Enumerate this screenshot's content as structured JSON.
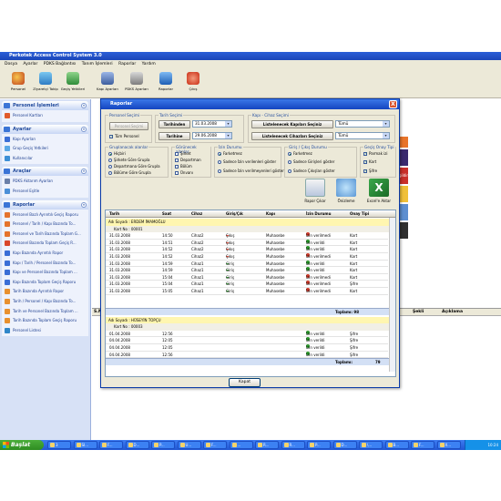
{
  "app": {
    "title": "Perkotek Access Control System 3.0",
    "menu": [
      "Dosya",
      "Ayarlar",
      "PDKS Bağlantısı",
      "Tanım İşlemleri",
      "Raporlar",
      "Yardım"
    ],
    "toolbar": [
      "Personel",
      "Ziyaretçi Takip",
      "Geçiş Yetkileri",
      "Kapı Ayarları",
      "PDKS Ayarları",
      "Raporlar",
      "Çıkış"
    ]
  },
  "sidebar": {
    "sections": [
      {
        "title": "Personel İşlemleri",
        "items": [
          "Personel Kartları"
        ]
      },
      {
        "title": "Ayarlar",
        "items": [
          "Kapı Ayarları",
          "Grup Geçiş Yetkileri",
          "Kullanıcılar"
        ]
      },
      {
        "title": "Araçlar",
        "items": [
          "PDKS Aktarım Ayarları",
          "Personel Eşitle"
        ]
      },
      {
        "title": "Raporlar",
        "items": [
          "Personel Bazlı Ayrıntılı Geçiş Raporu",
          "Personel / Tarih / Kapı Bazında To...",
          "Personel ve Tarih Bazında Toplam G...",
          "Personel Bazında Toplam Geçiş R...",
          "Kapı Bazında Ayrıntılı Rapor",
          "Kapı / Tarih / Personel Bazında To...",
          "Kapı ve Personel Bazında Toplam ...",
          "Kapı Bazında Toplam Geçiş Raporu",
          "Tarih Bazında Ayrıntılı Rapor",
          "Tarih / Personel / Kapı Bazında To...",
          "Tarih ve Personel Bazında Toplam ...",
          "Tarih Bazında Toplam Geçiş Raporu",
          "Personel Listesi"
        ]
      }
    ]
  },
  "background_table": {
    "headers": [
      "S.No",
      "Şekli",
      "Açıklama"
    ]
  },
  "ad_text": "gildir.",
  "dialog": {
    "title": "Raporlar",
    "close_label": "X",
    "personel_secimi": {
      "legend": "Personel Seçimi",
      "button": "Personel Seçimi",
      "all_label": "Tüm Personel"
    },
    "tarih_secimi": {
      "legend": "Tarih Seçimi",
      "from_label": "Tarihinden",
      "from_value": "31.03.2008",
      "to_label": "Tarihine",
      "to_value": "29.06.2008"
    },
    "kapi_cihaz_secimi": {
      "legend": "Kapı - Cihaz Seçimi",
      "kapi_label": "Listelenecek Kapıları Seçiniz",
      "kapi_value": "Tümü",
      "cihaz_label": "Listelenecek Cihazları Seçiniz",
      "cihaz_value": "Tümü"
    },
    "gruplama": {
      "legend": "Gruplanacak alanlar",
      "options": [
        "Hiçbiri",
        "Şirkete Göre Grupla",
        "Departmana Göre Grupla",
        "Bölüme Göre Grupla"
      ],
      "selected": 0
    },
    "gorunecek": {
      "legend": "Görünecek alanlar",
      "options": [
        "Şirket",
        "Departman",
        "Bölüm",
        "Ünvanı"
      ]
    },
    "izin_durumu": {
      "legend": "İzin Durumu",
      "options": [
        "Farketmez",
        "Sadece İzin verilenleri göster",
        "Sadece İzin verilmeyenleri göster"
      ],
      "selected": 0
    },
    "giris_cikis": {
      "legend": "Giriş / Çıkış Durumu",
      "options": [
        "Farketmez",
        "Sadece Girişleri göster",
        "Sadece Çıkışları göster"
      ],
      "selected": 0
    },
    "onay_tipi": {
      "legend": "Geçiş Onay Tipi",
      "options": [
        "Parmak izi",
        "Kart",
        "Şifre"
      ]
    },
    "actions": [
      "Rapor Çıkar",
      "Önizleme",
      "Excel'e Aktar"
    ],
    "grid": {
      "headers": [
        "Tarih",
        "Saat",
        "Cihaz",
        "Giriş/Çık",
        "Kapı",
        "İzin Durumu",
        "Onay Tipi"
      ],
      "groups": [
        {
          "name_label": "Adı Soyadı : ERDEM İMAMOĞLU",
          "card_label": "Kart No : 00001",
          "rows": [
            [
              "31.03.2008",
              "14:50",
              "Cihaz2",
              "Çıkış",
              "Muhasebe",
              "İzin verilmedi",
              "Kart"
            ],
            [
              "31.03.2008",
              "14:51",
              "Cihaz2",
              "Çıkış",
              "Muhasebe",
              "İzin verildi",
              "Kart"
            ],
            [
              "31.03.2008",
              "14:52",
              "Cihaz2",
              "Çıkış",
              "Muhasebe",
              "İzin verildi",
              "Kart"
            ],
            [
              "31.03.2008",
              "14:52",
              "Cihaz2",
              "Çıkış",
              "Muhasebe",
              "İzin verilmedi",
              "Kart"
            ],
            [
              "31.03.2008",
              "14:59",
              "Cihaz1",
              "Giriş",
              "Muhasebe",
              "İzin verildi",
              "Kart"
            ],
            [
              "31.03.2008",
              "14:59",
              "Cihaz1",
              "Giriş",
              "Muhasebe",
              "İzin verildi",
              "Kart"
            ],
            [
              "31.03.2008",
              "15:04",
              "Cihaz1",
              "Giriş",
              "Muhasebe",
              "İzin verilmedi",
              "Kart"
            ],
            [
              "31.03.2008",
              "15:04",
              "Cihaz1",
              "Giriş",
              "Muhasebe",
              "İzin verilmedi",
              "Şifre"
            ],
            [
              "31.03.2008",
              "15:05",
              "Cihaz1",
              "Giriş",
              "Muhasebe",
              "İzin verilmedi",
              "Kart"
            ]
          ],
          "statuses": [
            "deny",
            "ok",
            "ok",
            "deny",
            "ok",
            "ok",
            "deny",
            "deny",
            "deny"
          ],
          "total_label": "Toplamı: 98"
        },
        {
          "name_label": "Adı Soyadı : HÜSEYİN TOPÇU",
          "card_label": "Kart No : 00003",
          "rows": [
            [
              "01.04.2008",
              "12:56",
              "",
              "",
              "",
              "İzin verildi",
              "Şifre"
            ],
            [
              "04.04.2008",
              "12:05",
              "",
              "",
              "",
              "İzin verildi",
              "Şifre"
            ],
            [
              "04.04.2008",
              "12:05",
              "",
              "",
              "",
              "İzin verildi",
              "Şifre"
            ],
            [
              "04.04.2008",
              "12:56",
              "",
              "",
              "",
              "İzin verildi",
              "Şifre"
            ]
          ],
          "statuses": [
            "ok",
            "ok",
            "ok",
            "ok"
          ],
          "total_label": "Toplamı:",
          "total_value": "79"
        }
      ]
    },
    "close_button": "Kapat"
  },
  "taskbar": {
    "start_label": "Başlat",
    "buttons": [
      "3",
      "SI...",
      "F...",
      "D...",
      "P...",
      "U...",
      "F...",
      "...",
      "R...",
      "R...",
      "P...",
      "D...",
      "\\...",
      "B...",
      "F...",
      "X..."
    ],
    "clock": "10:24"
  },
  "colors": {
    "title_blue": "#1445c0",
    "allow_green": "#2e9e2e",
    "deny_red": "#d23b2b",
    "group_yellow": "#fff6b0"
  }
}
